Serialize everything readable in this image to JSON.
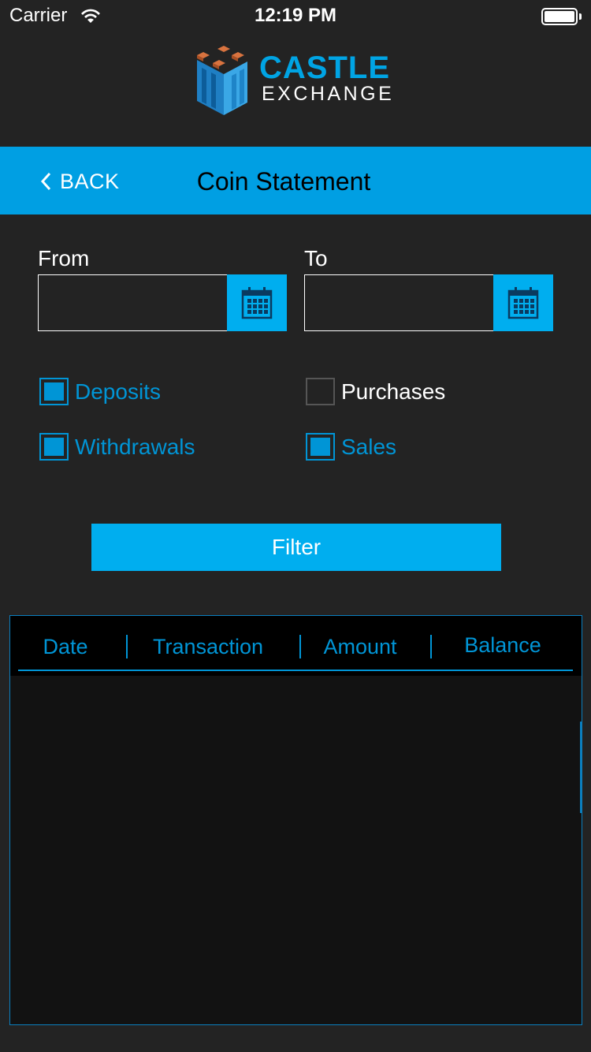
{
  "status_bar": {
    "carrier": "Carrier",
    "time": "12:19 PM",
    "icons": [
      "wifi-icon",
      "battery-icon"
    ]
  },
  "logo": {
    "line1": "CASTLE",
    "line2": "EXCHANGE",
    "icon": "castle-logo-icon"
  },
  "nav": {
    "back_label": "BACK",
    "title": "Coin Statement",
    "back_icon": "chevron-left-icon"
  },
  "dates": {
    "from_label": "From",
    "to_label": "To",
    "from_value": "",
    "to_value": "",
    "calendar_icon": "calendar-icon"
  },
  "filters": [
    {
      "label": "Deposits",
      "checked": true
    },
    {
      "label": "Purchases",
      "checked": false
    },
    {
      "label": "Withdrawals",
      "checked": true
    },
    {
      "label": "Sales",
      "checked": true
    }
  ],
  "filter_button": "Filter",
  "table": {
    "columns": [
      "Date",
      "Transaction",
      "Amount",
      "Balance"
    ],
    "rows": []
  },
  "colors": {
    "accent": "#009fe3",
    "button": "#00aeef",
    "checked": "#0095d6",
    "background": "#232323",
    "table_bg": "#121212"
  }
}
